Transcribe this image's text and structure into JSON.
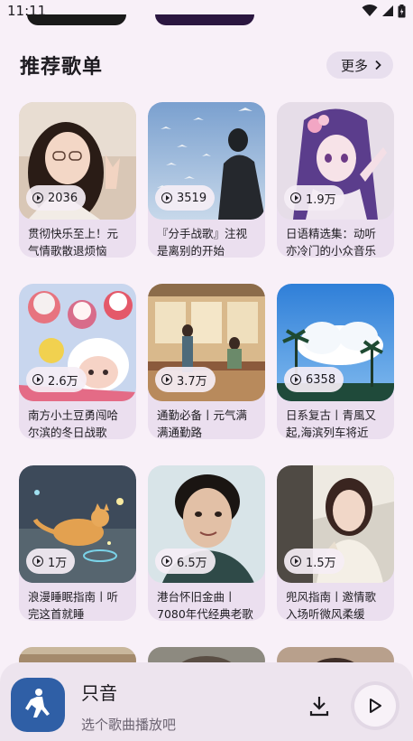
{
  "status": {
    "time": "11:11"
  },
  "section": {
    "title": "推荐歌单",
    "more_label": "更多"
  },
  "playlists": [
    {
      "plays": "2036",
      "title": "贯彻快乐至上！元气情歌散退烦恼"
    },
    {
      "plays": "3519",
      "title": "『分手战歌』注视是离别的开始"
    },
    {
      "plays": "1.9万",
      "title": "日语精选集：动听亦冷门的小众音乐"
    },
    {
      "plays": "2.6万",
      "title": "南方小土豆勇闯哈尔滨的冬日战歌"
    },
    {
      "plays": "3.7万",
      "title": "通勤必备丨元气满满通勤路"
    },
    {
      "plays": "6358",
      "title": "日系复古丨青風又起,海滨列车将近"
    },
    {
      "plays": "1万",
      "title": "浪漫睡眠指南丨听完这首就睡"
    },
    {
      "plays": "6.5万",
      "title": "港台怀旧金曲丨7080年代经典老歌"
    },
    {
      "plays": "1.5万",
      "title": "兜风指南丨邀情歌入场听微风柔缓"
    }
  ],
  "player": {
    "title": "只音",
    "subtitle": "选个歌曲播放吧"
  },
  "icons": {
    "status": [
      "wifi-icon",
      "signal-icon",
      "battery-icon"
    ],
    "more": "chevron-right-icon",
    "play_count": "play-circle-icon",
    "download": "download-icon",
    "play": "play-icon"
  },
  "colors": {
    "background": "#f8f0f8",
    "card": "#ebdfef",
    "player_art": "#2f5fa6"
  }
}
